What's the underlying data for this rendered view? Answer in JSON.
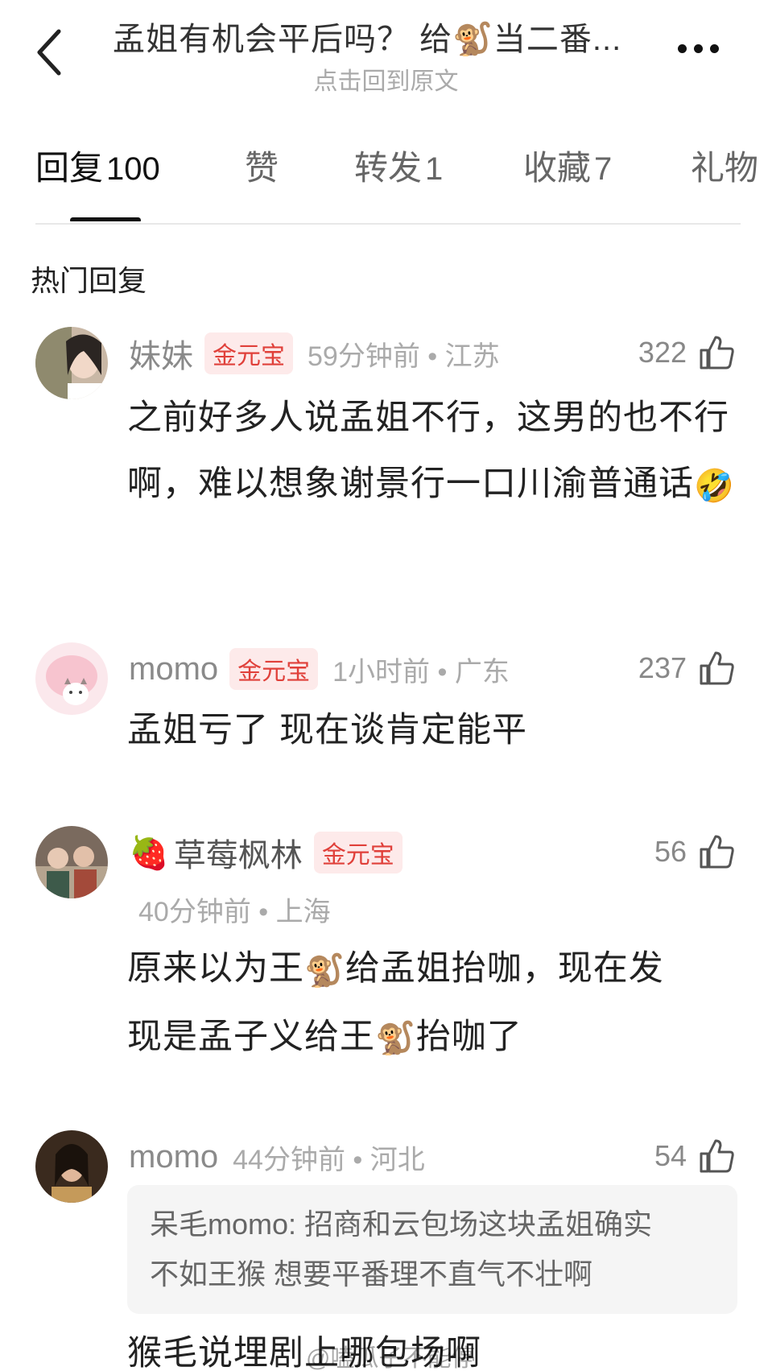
{
  "header": {
    "title": "孟姐有机会平后吗？ 给🐒当二番...",
    "subtitle": "点击回到原文"
  },
  "tabs": [
    {
      "label": "回复",
      "count": "100"
    },
    {
      "label": "赞",
      "count": ""
    },
    {
      "label": "转发",
      "count": "1"
    },
    {
      "label": "收藏",
      "count": "7"
    },
    {
      "label": "礼物",
      "count": ""
    }
  ],
  "section_title": "热门回复",
  "comments": [
    {
      "username": "妹妹",
      "badge": "金元宝",
      "time_location": "59分钟前 • 江苏",
      "likes": "322",
      "text": "之前好多人说孟姐不行，这男的也不行啊，难以想象谢景行一口川渝普通话",
      "emoji": "🤣"
    },
    {
      "username": "momo",
      "badge": "金元宝",
      "time_location": "1小时前 • 广东",
      "likes": "237",
      "text": "孟姐亏了 现在谈肯定能平"
    },
    {
      "username_emoji": "🍓",
      "username": "草莓枫林",
      "badge": "金元宝",
      "time_location": "40分钟前 • 上海",
      "likes": "56",
      "text_line1_a": "原来以为王",
      "text_line1_b": "给孟姐抬咖，现在发",
      "text_line2_a": "现是孟子义给王",
      "text_line2_b": "抬咖了",
      "monkey": "🐒"
    },
    {
      "username": "momo",
      "time_location": "44分钟前 • 河北",
      "likes": "54",
      "quote_line1": "呆毛momo: 招商和云包场这块孟姐确实",
      "quote_line2": "不如王猴  想要平番理不直气不壮啊",
      "text": "猴毛说埋剧上哪包场啊"
    }
  ],
  "watermark": "@嗑瓜子不能停",
  "colors": {
    "badge_bg": "#fdeaea",
    "badge_text": "#e0403a",
    "muted_text": "#aaaaaa"
  }
}
